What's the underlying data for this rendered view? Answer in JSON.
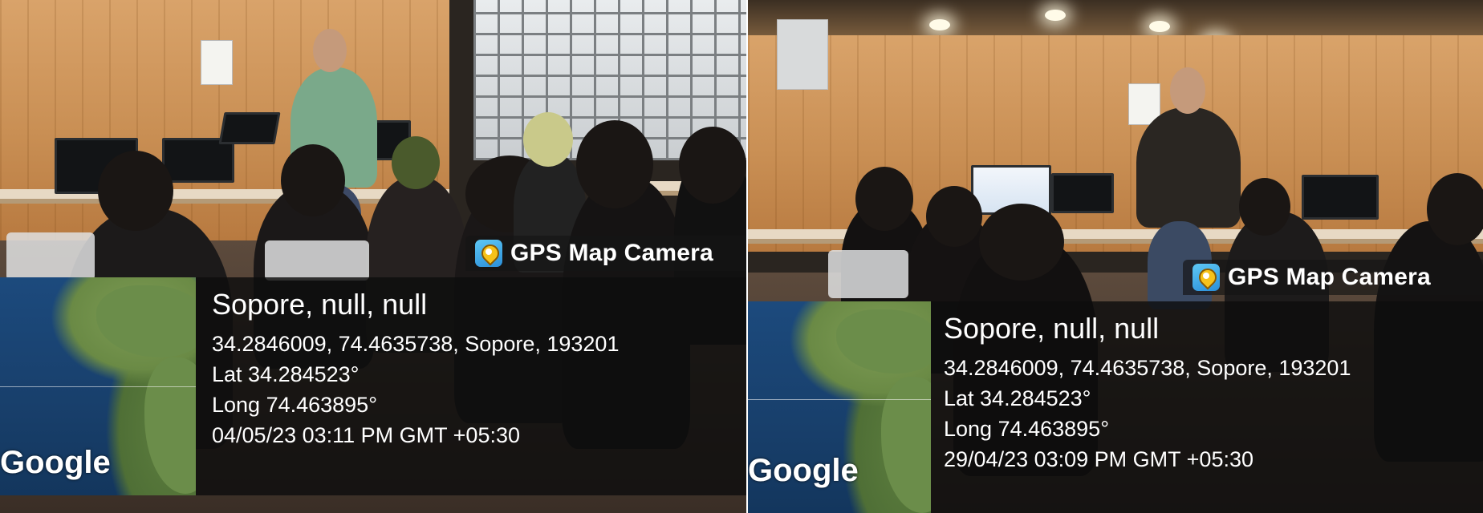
{
  "photos": [
    {
      "gps_label": "GPS Map Camera",
      "location_title": "Sopore, null, null",
      "address_line": "34.2846009, 74.4635738, Sopore, 193201",
      "latitude": "Lat 34.284523°",
      "longitude": "Long 74.463895°",
      "datetime": "04/05/23 03:11 PM GMT +05:30",
      "map_brand": "Google"
    },
    {
      "gps_label": "GPS Map Camera",
      "location_title": "Sopore, null, null",
      "address_line": "34.2846009, 74.4635738, Sopore, 193201",
      "latitude": "Lat 34.284523°",
      "longitude": "Long 74.463895°",
      "datetime": "29/04/23 03:09 PM GMT +05:30",
      "map_brand": "Google"
    }
  ],
  "colors": {
    "overlay": "#0e0e0e",
    "text": "#ffffff",
    "map_ocean": "#1c4a7d",
    "map_land": "#6b8d4a"
  },
  "icons": [
    "gps-map-camera-icon"
  ]
}
